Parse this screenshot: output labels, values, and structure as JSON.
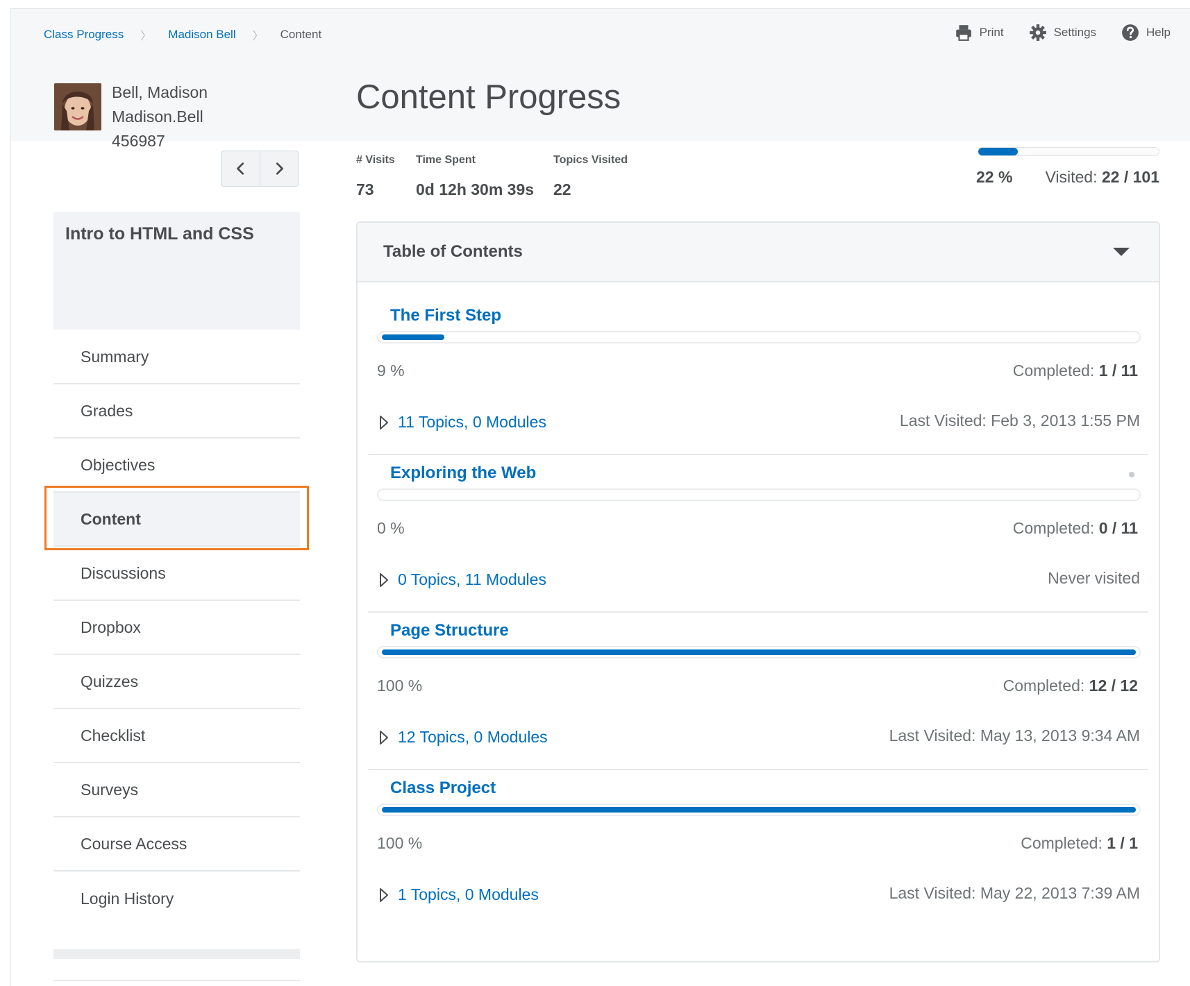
{
  "breadcrumb": {
    "items": [
      {
        "label": "Class Progress",
        "link": true
      },
      {
        "label": "Madison Bell",
        "link": true
      },
      {
        "label": "Content",
        "link": false
      }
    ]
  },
  "actions": {
    "print": "Print",
    "settings": "Settings",
    "help": "Help"
  },
  "profile": {
    "name": "Bell, Madison",
    "username": "Madison.Bell",
    "org_id": "456987"
  },
  "page": {
    "title": "Content Progress"
  },
  "course": {
    "name": "Intro to HTML and CSS"
  },
  "sidebar": {
    "items": [
      {
        "label": "Summary",
        "active": false
      },
      {
        "label": "Grades",
        "active": false
      },
      {
        "label": "Objectives",
        "active": false
      },
      {
        "label": "Content",
        "active": true
      },
      {
        "label": "Discussions",
        "active": false
      },
      {
        "label": "Dropbox",
        "active": false
      },
      {
        "label": "Quizzes",
        "active": false
      },
      {
        "label": "Checklist",
        "active": false
      },
      {
        "label": "Surveys",
        "active": false
      },
      {
        "label": "Course Access",
        "active": false
      },
      {
        "label": "Login History",
        "active": false
      }
    ]
  },
  "stats": {
    "visits_label": "# Visits",
    "visits_value": "73",
    "time_label": "Time Spent",
    "time_value": "0d 12h 30m 39s",
    "topics_label": "Topics Visited",
    "topics_value": "22"
  },
  "overall": {
    "percent": 22,
    "percent_text": "22 %",
    "visited_label": "Visited: ",
    "visited_value": "22 / 101"
  },
  "toc": {
    "title": "Table of Contents",
    "modules": [
      {
        "title": "The First Step",
        "percent": 9,
        "percent_text": "9 %",
        "completed_label": "Completed: ",
        "completed_value": "1 / 11",
        "topics": "11 Topics, 0 Modules",
        "last_visited": "Last Visited: Feb 3, 2013 1:55 PM",
        "dot": false
      },
      {
        "title": "Exploring the Web",
        "percent": 0,
        "percent_text": "0 %",
        "completed_label": "Completed: ",
        "completed_value": "0 / 11",
        "topics": "0 Topics, 11 Modules",
        "last_visited": "Never visited",
        "dot": true
      },
      {
        "title": "Page Structure",
        "percent": 100,
        "percent_text": "100 %",
        "completed_label": "Completed: ",
        "completed_value": "12 / 12",
        "topics": "12 Topics, 0 Modules",
        "last_visited": "Last Visited: May 13, 2013 9:34 AM",
        "dot": false
      },
      {
        "title": "Class Project",
        "percent": 100,
        "percent_text": "100 %",
        "completed_label": "Completed: ",
        "completed_value": "1 / 1",
        "topics": "1 Topics, 0 Modules",
        "last_visited": "Last Visited: May 22, 2013 7:39 AM",
        "dot": false
      }
    ]
  },
  "colors": {
    "brand": "#006fbf",
    "highlight": "#ef7a22",
    "text": "#494c4e"
  }
}
